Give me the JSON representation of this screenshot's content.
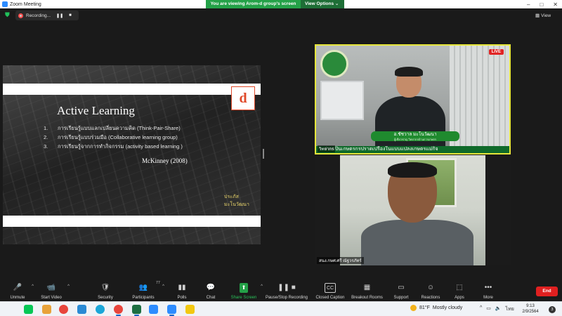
{
  "window": {
    "title": "Zoom Meeting",
    "controls": [
      "–",
      "□",
      "✕"
    ]
  },
  "share_banner": {
    "message": "You are viewing Arom-d group's screen",
    "view_options": "View Options ⌄"
  },
  "recording": {
    "label": "Recording...",
    "pause": "❚❚",
    "stop": "■"
  },
  "view_button": {
    "label": "View",
    "icon": "grid-icon"
  },
  "slide": {
    "logo_letter": "d",
    "title": "Active Learning",
    "items": [
      {
        "num": "1.",
        "text": "การเรียนรู้แบบแลกเปลี่ยนความคิด (Think-Pair-Share)"
      },
      {
        "num": "2.",
        "text": "การเรียนรู้แบบร่วมมือ (Collaborative learning group)"
      },
      {
        "num": "3.",
        "text": "การเรียนรู้จากการทำกิจกรรม  (activity based learning )"
      }
    ],
    "citation": "McKinney (2008)",
    "brand": "ประภัส\nมะโนวัฒนา"
  },
  "participants": [
    {
      "name_label": "วิทยากร",
      "live_badge": "LIVE",
      "lower_third_name": "อ.ชัชวาล  มะโนวัฒนา",
      "lower_third_sub": "ผู้เชี่ยวชาญ วิทยากรด้านการเกษตร",
      "ticker": "ร่วมเป็นเกษตรกรปราดเปรื่องในแบบแปลงเกษตรแม่กิจ"
    },
    {
      "name_label": "สนง.กษศ.ศรี ณัฐวรภัทร์"
    }
  ],
  "toolbar": {
    "items": [
      {
        "label": "Unmute",
        "icon": "mic-muted-icon",
        "glyph": "🎤",
        "caret": "^"
      },
      {
        "label": "Start Video",
        "icon": "video-off-icon",
        "glyph": "📹",
        "caret": "^"
      },
      {
        "label": "Security",
        "icon": "shield-icon",
        "glyph": "🛡"
      },
      {
        "label": "Participants",
        "icon": "participants-icon",
        "glyph": "👥",
        "count": "77",
        "caret": "^"
      },
      {
        "label": "Polls",
        "icon": "polls-icon",
        "glyph": "▮▮"
      },
      {
        "label": "Chat",
        "icon": "chat-icon",
        "glyph": "💬"
      },
      {
        "label": "Share Screen",
        "icon": "share-screen-icon",
        "glyph": "⬆",
        "caret": "^"
      },
      {
        "label": "Pause/Stop Recording",
        "icon": "pause-recording-icon",
        "glyph": "❚❚ ■"
      },
      {
        "label": "Closed Caption",
        "icon": "cc-icon",
        "glyph": "CC"
      },
      {
        "label": "Breakout Rooms",
        "icon": "breakout-icon",
        "glyph": "▦"
      },
      {
        "label": "Support",
        "icon": "support-icon",
        "glyph": "▭"
      },
      {
        "label": "Reactions",
        "icon": "reactions-icon",
        "glyph": "☺"
      },
      {
        "label": "Apps",
        "icon": "apps-icon",
        "glyph": "⬚"
      },
      {
        "label": "More",
        "icon": "more-icon",
        "glyph": "•••"
      }
    ],
    "end_label": "End"
  },
  "taskbar": {
    "weather_temp": "81°F",
    "weather_text": "Mostly cloudy",
    "language": "ไทย",
    "time": "9:13",
    "date": "2/9/2564",
    "notifications": "3",
    "apps": [
      {
        "name": "line-app-icon",
        "color": "#06c755"
      },
      {
        "name": "chrome-app-icon",
        "color": "#e8453c"
      },
      {
        "name": "edge-app-icon",
        "color": "#2a8ad4"
      },
      {
        "name": "file-explorer-app-icon",
        "color": "#f0c419"
      },
      {
        "name": "chrome2-app-icon",
        "color": "#1aa260"
      },
      {
        "name": "excel-app-icon",
        "color": "#1d6f42"
      },
      {
        "name": "zoom-app-icon",
        "color": "#2d8cff"
      },
      {
        "name": "zoom2-app-icon",
        "color": "#2d8cff"
      },
      {
        "name": "powerbi-app-icon",
        "color": "#f2c811"
      }
    ]
  }
}
